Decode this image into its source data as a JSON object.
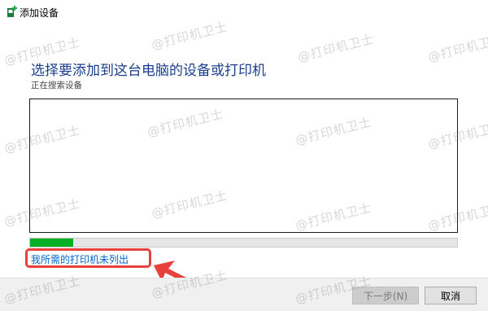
{
  "window": {
    "title": "添加设备",
    "icon": "device-add-icon"
  },
  "main": {
    "heading": "选择要添加到这台电脑的设备或打印机",
    "status": "正在搜索设备",
    "progress_percent": 10,
    "not_listed_link": "我所需的打印机未列出"
  },
  "footer": {
    "next_label": "下一步(N)",
    "cancel_label": "取消"
  },
  "annotation": {
    "highlight_color": "#e8403a",
    "arrow_icon": "red-arrow-icon"
  },
  "watermark": {
    "text": "@打印机卫士"
  },
  "colors": {
    "heading": "#1b3f8c",
    "link": "#0066cc",
    "progress": "#06b025"
  }
}
